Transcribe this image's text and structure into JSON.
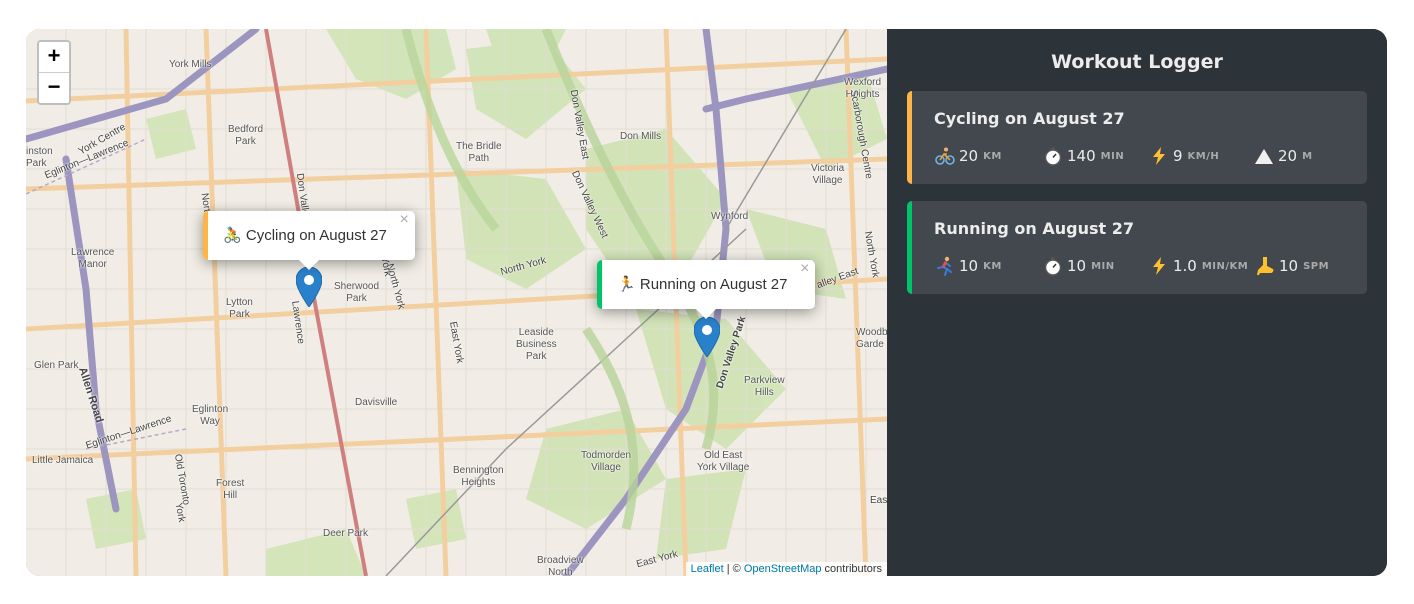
{
  "app": {
    "title": "Workout Logger"
  },
  "map": {
    "zoom_in": "+",
    "zoom_out": "−",
    "attribution": {
      "leaflet": "Leaflet",
      "separator": " | © ",
      "osm": "OpenStreetMap",
      "suffix": " contributors"
    },
    "labels": {
      "york_mills": "York Mills",
      "bedford_park": "Bedford\nPark",
      "the_bridle_path": "The Bridle\nPath",
      "don_mills": "Don Mills",
      "wexford": "Wexford\nHeights",
      "victoria_village": "Victoria\nVillage",
      "wynford": "Wynford",
      "lawrence_manor": "Lawrence\nManor",
      "lytton_park": "Lytton\nPark",
      "sherwood_park": "Sherwood\nPark",
      "leaside": "Leaside\nBusiness\nPark",
      "parkview_hills": "Parkview\nHills",
      "glen_park": "Glen Park",
      "eglinton_way": "Eglinton\nWay",
      "davisville": "Davisville",
      "little_jamaica": "Little Jamaica",
      "forest_hill": "Forest\nHill",
      "bennington": "Bennington\nHeights",
      "todmorden": "Todmorden\nVillage",
      "old_east_york": "Old East\nYork Village",
      "deer_park": "Deer Park",
      "broadview": "Broadview\nNorth",
      "woodbine_gardens": "Woodb\nGarde",
      "inston_park": "inston\nPark",
      "york_centre": "York Centre",
      "eglinton_lawrence_top": "Eglinton—Lawrence",
      "eglinton_lawrence_bottom": "Eglinton—Lawrence",
      "allen_road": "Allen Road",
      "don_valley_east": "Don Valley East",
      "don_valley_west": "Don Valley West",
      "north_york": "North York",
      "north_york_2": "North York",
      "north_york_3": "North York",
      "east_york": "East York",
      "east_york_2": "East York",
      "scarborough_centre": "Scarborough Centre",
      "don_valley_park": "Don Valley Park",
      "old_toronto": "Old Toronto",
      "york": "York",
      "lawrence": "Lawrence",
      "don_valley_north": "Don Valle",
      "nort": "Nort",
      "york_2": "York",
      "valley_east": "alley East",
      "eas": "Eas"
    },
    "popups": [
      {
        "text": "Cycling on August 27",
        "icon": "cyclist-icon",
        "accent": "#ffb545"
      },
      {
        "text": "Running on August 27",
        "icon": "runner-icon",
        "accent": "#00c46a"
      }
    ]
  },
  "workouts": [
    {
      "title": "Cycling on August 27",
      "accent": "#ffb545",
      "stats": [
        {
          "icon": "cyclist-icon",
          "value": "20",
          "unit": "KM"
        },
        {
          "icon": "stopwatch-icon",
          "value": "140",
          "unit": "MIN"
        },
        {
          "icon": "lightning-icon",
          "value": "9",
          "unit": "KM/H"
        },
        {
          "icon": "mountain-icon",
          "value": "20",
          "unit": "M"
        }
      ]
    },
    {
      "title": "Running on August 27",
      "accent": "#00c46a",
      "stats": [
        {
          "icon": "runner-icon",
          "value": "10",
          "unit": "KM"
        },
        {
          "icon": "stopwatch-icon",
          "value": "10",
          "unit": "MIN"
        },
        {
          "icon": "lightning-icon",
          "value": "1.0",
          "unit": "MIN/KM"
        },
        {
          "icon": "footprint-icon",
          "value": "10",
          "unit": "SPM"
        }
      ]
    }
  ]
}
